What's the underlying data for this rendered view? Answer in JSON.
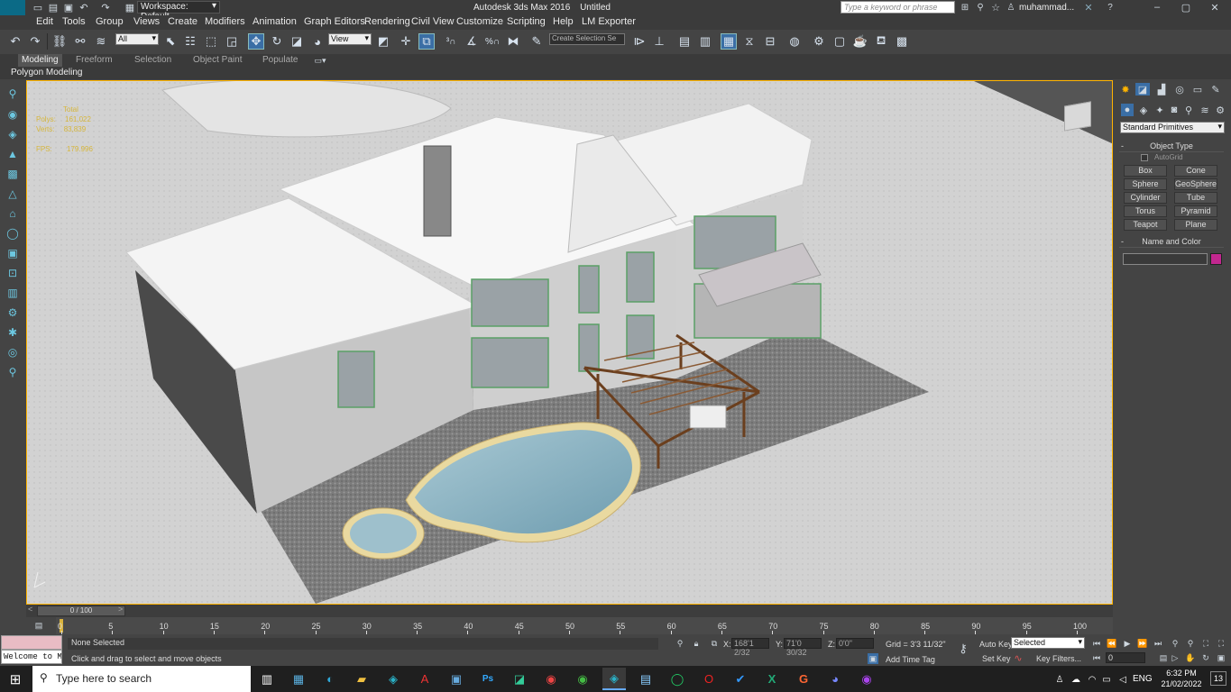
{
  "app": {
    "title": "Autodesk 3ds Max 2016",
    "document": "Untitled",
    "logo": "MAX",
    "workspace": "Workspace: Default",
    "search_placeholder": "Type a keyword or phrase",
    "user": "muhammad..."
  },
  "menu": [
    "Edit",
    "Tools",
    "Group",
    "Views",
    "Create",
    "Modifiers",
    "Animation",
    "Graph Editors",
    "Rendering",
    "Civil View",
    "Customize",
    "Scripting",
    "Help",
    "LM Exporter"
  ],
  "toolbar": {
    "filter": "All",
    "ref_coord": "View",
    "selection_set": "Create Selection Se"
  },
  "ribbon": {
    "tabs": [
      "Modeling",
      "Freeform",
      "Selection",
      "Object Paint",
      "Populate"
    ],
    "sub": "Polygon Modeling"
  },
  "viewport": {
    "stats": {
      "total_label": "Total",
      "polys_label": "Polys:",
      "polys": "161,022",
      "verts_label": "Verts:",
      "verts": "83,839",
      "fps_label": "FPS:",
      "fps": "179.996"
    }
  },
  "command_panel": {
    "dropdown": "Standard Primitives",
    "object_type": "Object Type",
    "autogrid": "AutoGrid",
    "buttons": [
      "Box",
      "Cone",
      "Sphere",
      "GeoSphere",
      "Cylinder",
      "Tube",
      "Torus",
      "Pyramid",
      "Teapot",
      "Plane"
    ],
    "name_color": "Name and Color",
    "color_swatch": "#c2278f"
  },
  "time_slider": {
    "value": "0 / 100"
  },
  "trackbar": {
    "ticks": [
      "0",
      "5",
      "10",
      "15",
      "20",
      "25",
      "30",
      "35",
      "40",
      "45",
      "50",
      "55",
      "60",
      "65",
      "70",
      "75",
      "80",
      "85",
      "90",
      "95",
      "100"
    ]
  },
  "status": {
    "maxscript": "Welcome to M",
    "selection": "None Selected",
    "prompt": "Click and drag to select and move objects",
    "x_label": "X:",
    "x": "168'1 2/32",
    "y_label": "Y:",
    "y": "71'0 30/32",
    "z_label": "Z:",
    "z": "0'0\"",
    "grid": "Grid = 3'3 11/32\"",
    "add_time_tag": "Add Time Tag",
    "auto_key": "Auto Key",
    "selected": "Selected",
    "set_key": "Set Key",
    "key_filters": "Key Filters...",
    "frame": "0"
  },
  "taskbar": {
    "search": "Type here to search",
    "lang": "ENG",
    "time": "6:32 PM",
    "date": "21/02/2022",
    "notif": "13"
  }
}
